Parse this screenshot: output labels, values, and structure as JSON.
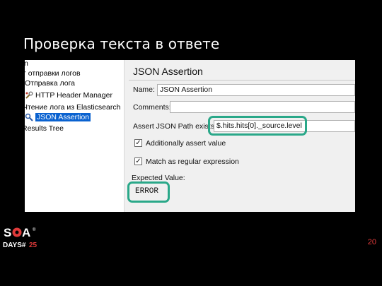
{
  "slide": {
    "title": "Проверка текста в ответе",
    "page_number": "20",
    "logo_top": "SQA",
    "logo_bottom": "DAYS#25"
  },
  "tree": {
    "items": [
      {
        "label": "n",
        "icon": ""
      },
      {
        "label": "т отправки логов",
        "icon": ""
      },
      {
        "label": "Отправка лога",
        "icon": ""
      },
      {
        "label": "HTTP Header Manager",
        "icon": "wrench-icon"
      },
      {
        "label": "Чтение лога из Elasticsearch",
        "icon": ""
      },
      {
        "label": "JSON Assertion",
        "icon": "magnifier-icon",
        "selected": true
      },
      {
        "label": "Results Tree",
        "icon": ""
      }
    ]
  },
  "panel": {
    "title": "JSON Assertion",
    "name_label": "Name:",
    "name_value": "JSON Assertion",
    "comments_label": "Comments:",
    "comments_value": "",
    "path_label": "Assert JSON Path exists:",
    "path_value": "$.hits.hits[0]._source.level",
    "chk_additional": "Additionally assert value",
    "chk_regex": "Match as regular expression",
    "expected_label": "Expected Value:",
    "expected_value": "ERROR",
    "highlight_color": "#2aa889"
  }
}
